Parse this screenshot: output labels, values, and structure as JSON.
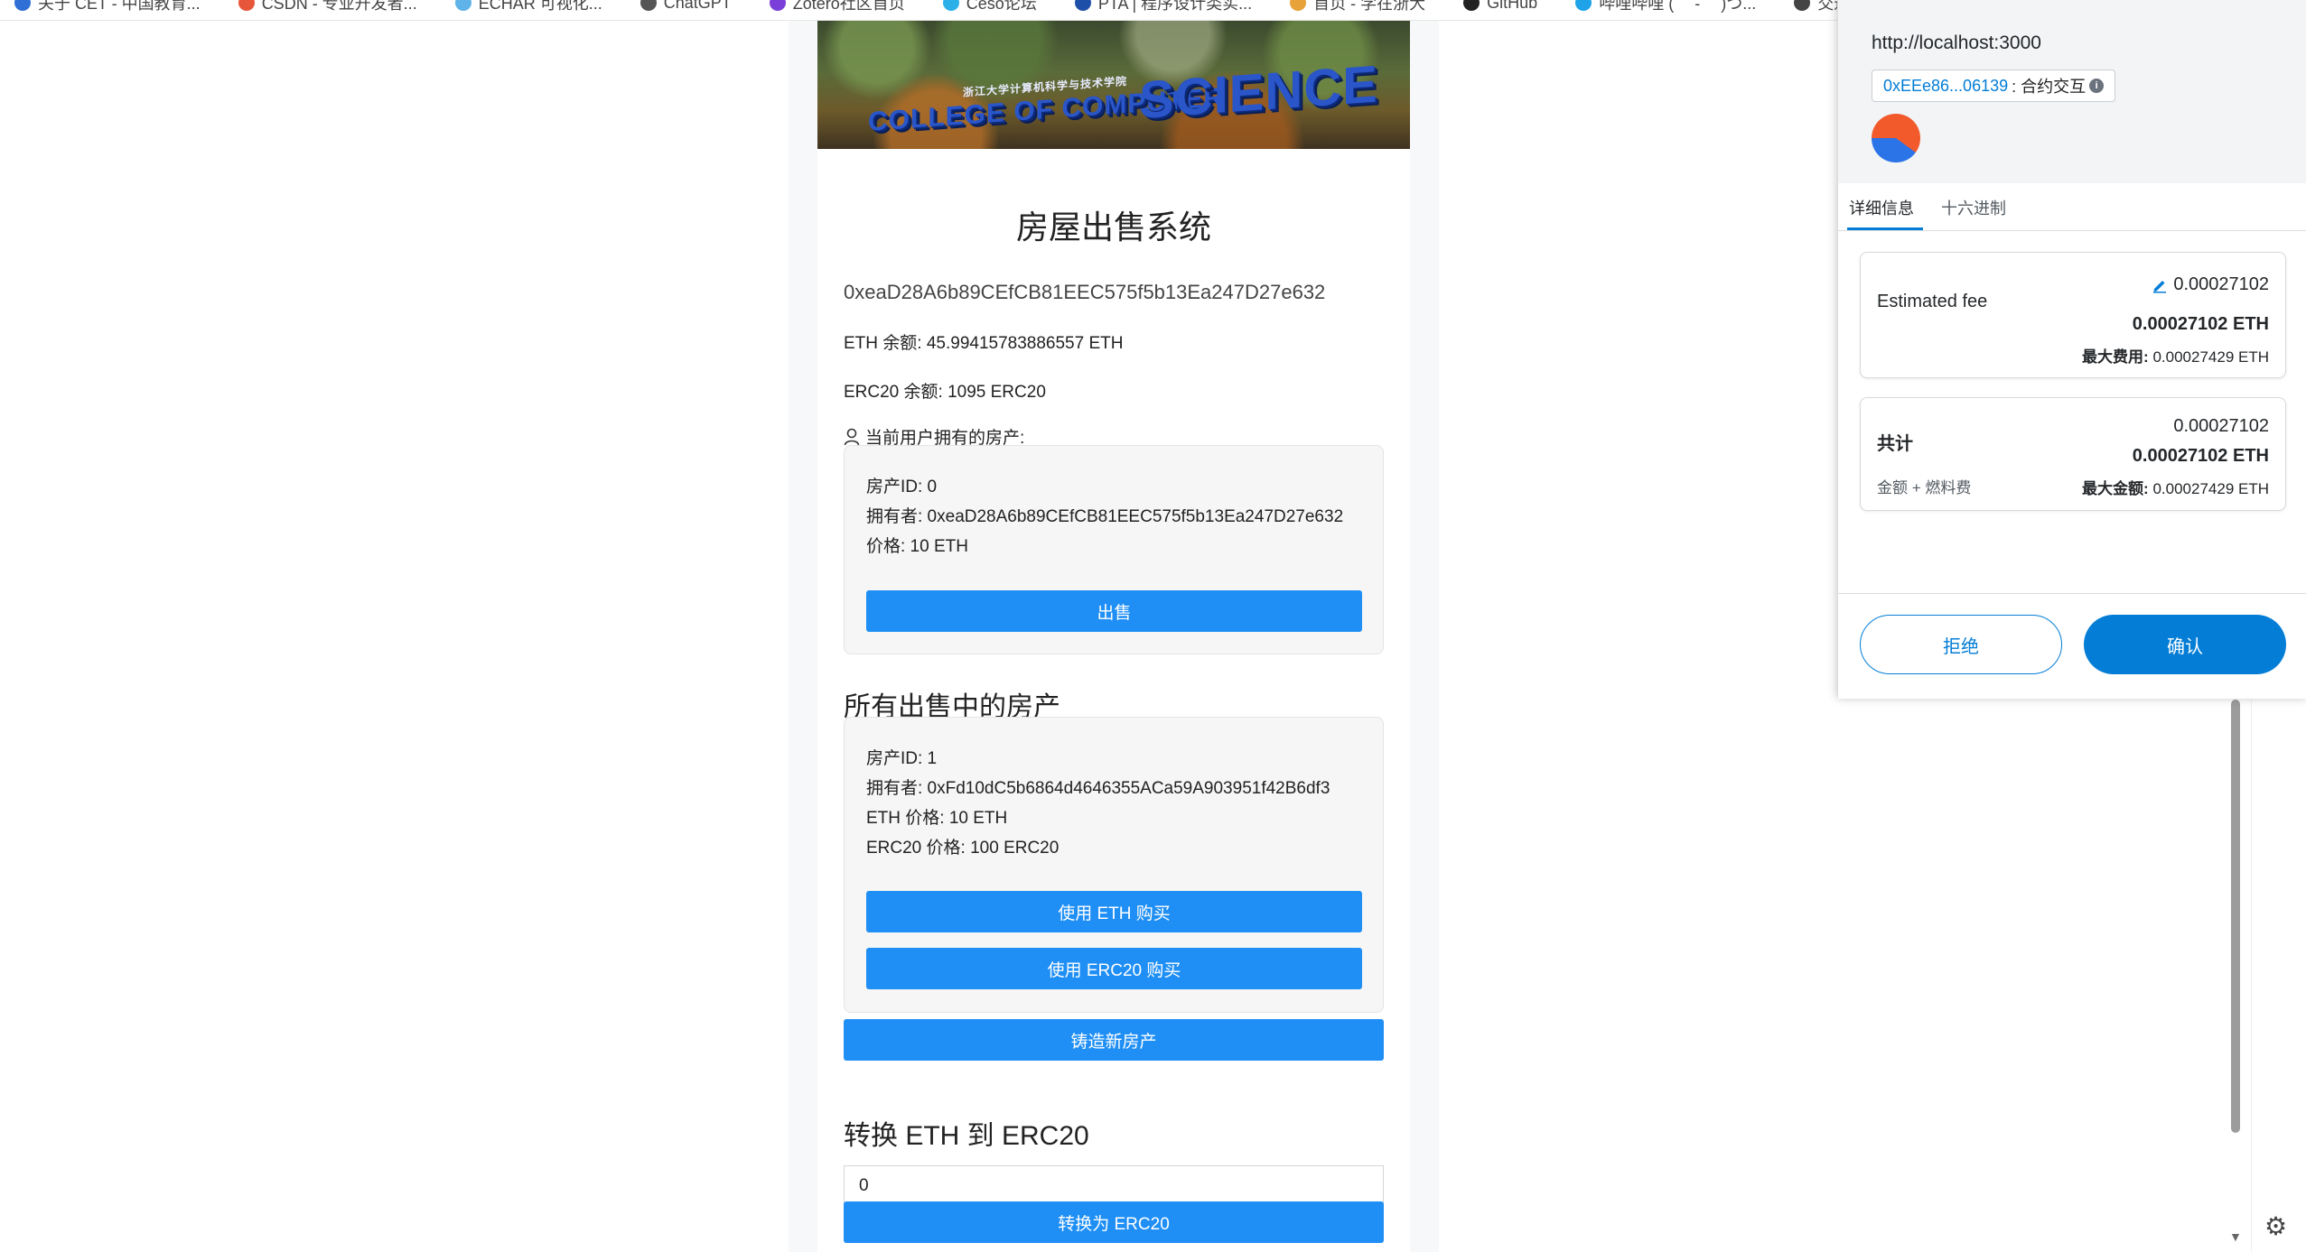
{
  "bookmarks": [
    {
      "label": "关于 CET - 中国教育...",
      "color": "#2f6fd6"
    },
    {
      "label": "CSDN - 专业开发者...",
      "color": "#e8563a"
    },
    {
      "label": "ECHAR 可视化...",
      "color": "#5fb3e8"
    },
    {
      "label": "ChatGPT",
      "color": "#555555"
    },
    {
      "label": "Zotero社区首页",
      "color": "#7a3fd9"
    },
    {
      "label": "Ceso论坛",
      "color": "#2bb0e8"
    },
    {
      "label": "PTA | 程序设计类实...",
      "color": "#1d4fa8"
    },
    {
      "label": "首页 - 学在浙大",
      "color": "#e8a23a"
    },
    {
      "label": "GitHub",
      "color": "#222222"
    },
    {
      "label": "哔哩哔哩 ( ゜- ゜)つ...",
      "color": "#1fa3e8"
    },
    {
      "label": "交通指示等 - 浙江...",
      "color": "#444444"
    }
  ],
  "banner": {
    "sign_small": "COLLEGE OF COMPUTER",
    "sign_big": "SCIENCE",
    "sign_cn": "浙江大学计算机科学与技术学院"
  },
  "app": {
    "title": "房屋出售系统",
    "account": "0xeaD28A6b89CEfCB81EEC575f5b13Ea247D27e632",
    "eth_balance": "ETH 余额: 45.99415783886557 ETH",
    "erc20_balance": "ERC20 余额: 1095 ERC20",
    "owned_label": "当前用户拥有的房产:",
    "owned_house": {
      "id": "房产ID: 0",
      "owner": "拥有者: 0xeaD28A6b89CEfCB81EEC575f5b13Ea247D27e632",
      "price": "价格: 10 ETH",
      "sell_button": "出售"
    },
    "for_sale_heading": "所有出售中的房产",
    "for_sale_house": {
      "id": "房产ID: 1",
      "owner": "拥有者: 0xFd10dC5b6864d4646355ACa59A903951f42B6df3",
      "eth_price": "ETH 价格: 10 ETH",
      "erc20_price": "ERC20 价格: 100 ERC20",
      "buy_eth_button": "使用 ETH 购买",
      "buy_erc20_button": "使用 ERC20 购买"
    },
    "mint_button": "铸造新房产",
    "convert_heading": "转换 ETH 到 ERC20",
    "convert_input_value": "0",
    "convert_button": "转换为 ERC20"
  },
  "metamask": {
    "origin": "http://localhost:3000",
    "account_short": "0xEEe86...06139",
    "interaction": ": 合约交互",
    "tabs": [
      "详细信息",
      "十六进制"
    ],
    "estimated_fee": {
      "label": "Estimated fee",
      "value_top": "0.00027102",
      "value_main": "0.00027102 ETH",
      "max_label": "最大费用:",
      "max_value": "0.00027429 ETH"
    },
    "total": {
      "label": "共计",
      "sublabel": "金额 + 燃料费",
      "value_top": "0.00027102",
      "value_main": "0.00027102 ETH",
      "max_label": "最大金额:",
      "max_value": "0.00027429 ETH"
    },
    "reject_button": "拒绝",
    "confirm_button": "确认"
  },
  "colors": {
    "app_button": "#1f8ff5",
    "metamask_primary": "#037dd6"
  }
}
